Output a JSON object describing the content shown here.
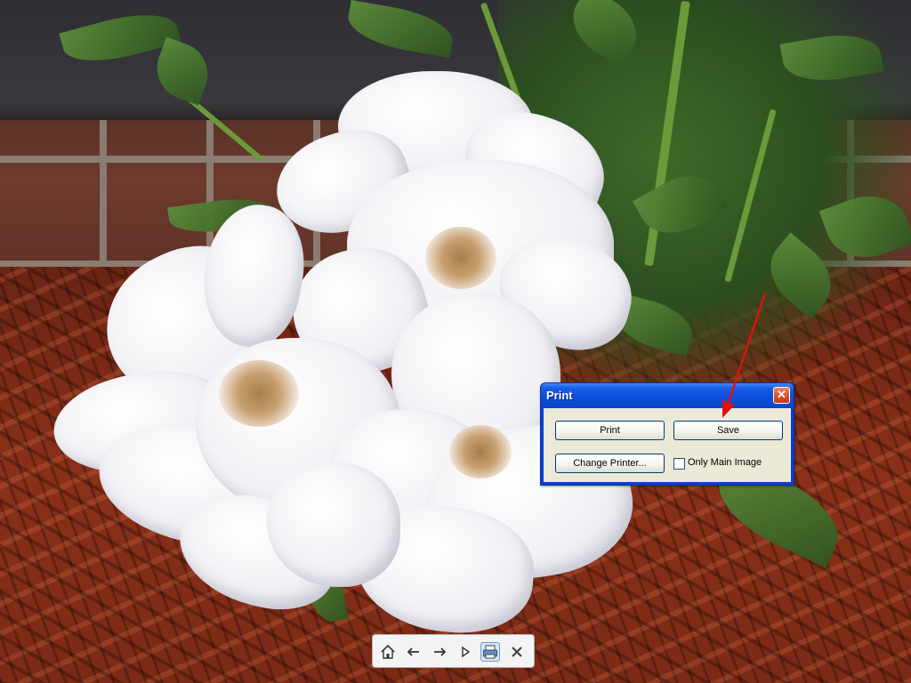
{
  "dialog": {
    "title": "Print",
    "close_glyph": "✕",
    "buttons": {
      "print_label": "Print",
      "save_label": "Save",
      "change_printer_label": "Change Printer..."
    },
    "only_main_image": {
      "label": "Only Main Image",
      "checked": false
    }
  },
  "toolbar": {
    "items": [
      {
        "icon": "home-icon"
      },
      {
        "icon": "arrow-left-icon"
      },
      {
        "icon": "arrow-right-icon"
      },
      {
        "icon": "play-icon"
      },
      {
        "icon": "print-icon",
        "active": true
      },
      {
        "icon": "close-icon"
      }
    ]
  },
  "colors": {
    "titlebar": "#0b4fd8",
    "dialog_body": "#ece9d8",
    "annotation_arrow": "#e01010"
  }
}
